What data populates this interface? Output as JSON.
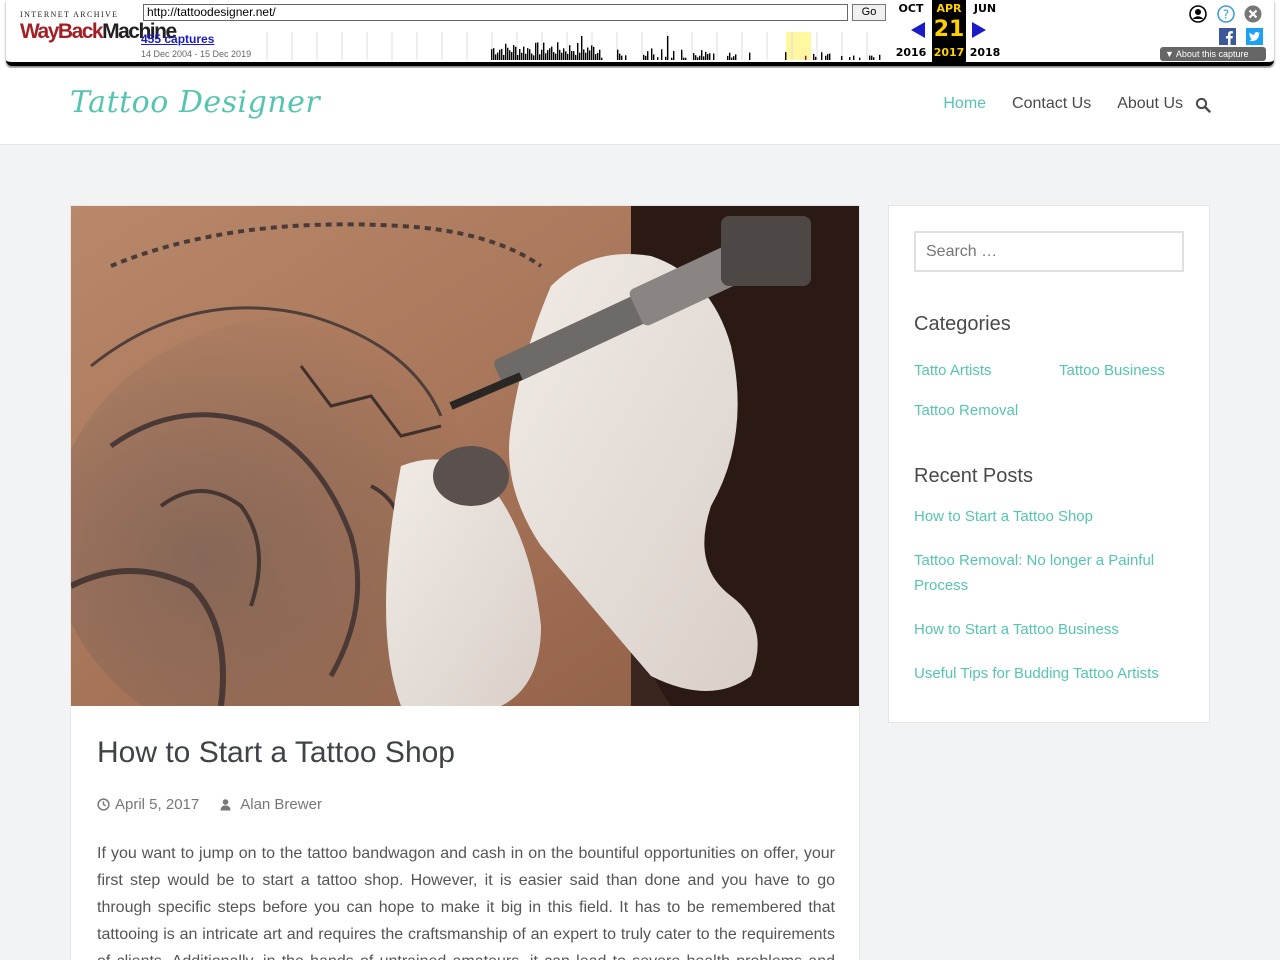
{
  "wayback": {
    "logo_top": "INTERNET ARCHIVE",
    "logo_main_a": "WayBack",
    "logo_main_b": "Machine",
    "url": "http://tattoodesigner.net/",
    "go_label": "Go",
    "captures": "455 captures",
    "range": "14 Dec 2004 - 15 Dec 2019",
    "prev_month": "OCT",
    "prev_year": "2016",
    "cur_month": "APR",
    "cur_day": "21",
    "cur_year": "2017",
    "next_month": "JUN",
    "next_year": "2018",
    "about": "About this capture"
  },
  "site": {
    "title": "Tattoo Designer",
    "nav": [
      "Home",
      "Contact Us",
      "About Us"
    ],
    "accent_color": "#56c5b0"
  },
  "post": {
    "title": "How to Start a Tattoo Shop",
    "date": "April 5, 2017",
    "author": "Alan Brewer",
    "body": "If you want to jump on to the tattoo bandwagon and cash in on the bountiful opportunities on offer, your first step would be to start a tattoo shop. However, it is easier said than done and you have to go through specific steps before you can hope to make it big in this field. It has to be remembered that tattooing is an intricate art and requires the craftsmanship of an expert to truly cater to the requirements of clients. Additionally, in the hands of untrained amateurs, it can lead to severe health problems and this can drag"
  },
  "sidebar": {
    "search_placeholder": "Search …",
    "categories_title": "Categories",
    "categories": [
      "Tatto Artists",
      "Tattoo Business",
      "Tattoo Removal"
    ],
    "recent_title": "Recent Posts",
    "recent": [
      "How to Start a Tattoo Shop",
      "Tattoo Removal: No longer a Painful Process",
      "How to Start a Tattoo Business",
      "Useful Tips for Budding Tattoo Artists"
    ]
  }
}
